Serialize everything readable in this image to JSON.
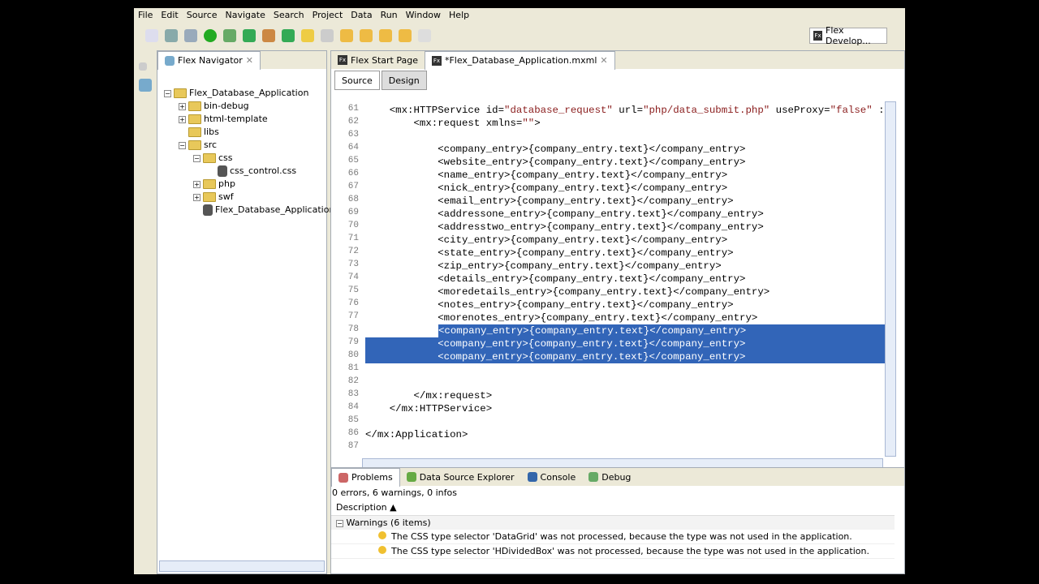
{
  "menu": [
    "File",
    "Edit",
    "Source",
    "Navigate",
    "Search",
    "Project",
    "Data",
    "Run",
    "Window",
    "Help"
  ],
  "perspective": "Flex Develop...",
  "navigator": {
    "title": "Flex Navigator",
    "tree": [
      {
        "label": "Flex_Database_Application",
        "level": 0,
        "type": "project"
      },
      {
        "label": "bin-debug",
        "level": 1,
        "type": "folder"
      },
      {
        "label": "html-template",
        "level": 1,
        "type": "folder"
      },
      {
        "label": "libs",
        "level": 1,
        "type": "folder"
      },
      {
        "label": "src",
        "level": 1,
        "type": "folder"
      },
      {
        "label": "css",
        "level": 2,
        "type": "folder"
      },
      {
        "label": "css_control.css",
        "level": 3,
        "type": "file"
      },
      {
        "label": "php",
        "level": 2,
        "type": "folder"
      },
      {
        "label": "swf",
        "level": 2,
        "type": "folder"
      },
      {
        "label": "Flex_Database_Application.r",
        "level": 2,
        "type": "file"
      }
    ]
  },
  "editor": {
    "tabs": [
      "Flex Start Page",
      "*Flex_Database_Application.mxml"
    ],
    "source_label": "Source",
    "design_label": "Design",
    "lines": [
      {
        "n": "61",
        "text": "    <mx:HTTPService id=\"database_request\" url=\"php/data_submit.php\" useProxy=\"false\" :"
      },
      {
        "n": "62",
        "text": "        <mx:request xmlns=\"\">"
      },
      {
        "n": "63",
        "text": ""
      },
      {
        "n": "64",
        "text": "            <company_entry>{company_entry.text}</company_entry>"
      },
      {
        "n": "65",
        "text": "            <website_entry>{company_entry.text}</company_entry>"
      },
      {
        "n": "66",
        "text": "            <name_entry>{company_entry.text}</company_entry>"
      },
      {
        "n": "67",
        "text": "            <nick_entry>{company_entry.text}</company_entry>"
      },
      {
        "n": "68",
        "text": "            <email_entry>{company_entry.text}</company_entry>"
      },
      {
        "n": "69",
        "text": "            <addressone_entry>{company_entry.text}</company_entry>"
      },
      {
        "n": "70",
        "text": "            <addresstwo_entry>{company_entry.text}</company_entry>"
      },
      {
        "n": "71",
        "text": "            <city_entry>{company_entry.text}</company_entry>"
      },
      {
        "n": "72",
        "text": "            <state_entry>{company_entry.text}</company_entry>"
      },
      {
        "n": "73",
        "text": "            <zip_entry>{company_entry.text}</company_entry>"
      },
      {
        "n": "74",
        "text": "            <details_entry>{company_entry.text}</company_entry>"
      },
      {
        "n": "75",
        "text": "            <moredetails_entry>{company_entry.text}</company_entry>"
      },
      {
        "n": "76",
        "text": "            <notes_entry>{company_entry.text}</company_entry>"
      },
      {
        "n": "77",
        "text": "            <morenotes_entry>{company_entry.text}</company_entry>"
      },
      {
        "n": "78",
        "text": "            <company_entry>{company_entry.text}</company_entry>"
      },
      {
        "n": "79",
        "text": "            <company_entry>{company_entry.text}</company_entry>"
      },
      {
        "n": "80",
        "text": "            <company_entry>{company_entry.text}</company_entry>"
      },
      {
        "n": "81",
        "text": ""
      },
      {
        "n": "82",
        "text": ""
      },
      {
        "n": "83",
        "text": "        </mx:request>"
      },
      {
        "n": "84",
        "text": "    </mx:HTTPService>"
      },
      {
        "n": "85",
        "text": ""
      },
      {
        "n": "86",
        "text": "</mx:Application>"
      },
      {
        "n": "87",
        "text": ""
      }
    ],
    "selected_lines": [
      "78",
      "79",
      "80"
    ]
  },
  "problems": {
    "tabs": [
      "Problems",
      "Data Source Explorer",
      "Console",
      "Debug"
    ],
    "summary": "0 errors, 6 warnings, 0 infos",
    "column": "Description",
    "group": "Warnings (6 items)",
    "items": [
      "The CSS type selector 'DataGrid' was not processed, because the type was not used in the application.",
      "The CSS type selector 'HDividedBox' was not processed, because the type was not used in the application."
    ]
  }
}
